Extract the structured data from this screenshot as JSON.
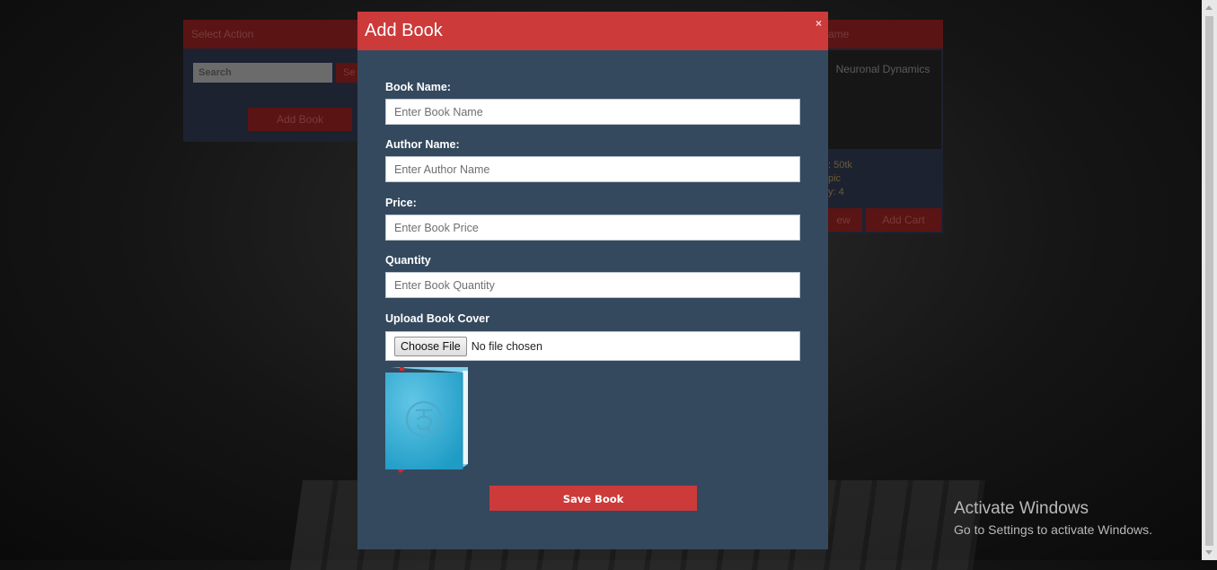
{
  "background": {
    "left_panel": {
      "header": "Select Action",
      "search_placeholder": "Search",
      "search_button": "Se",
      "add_button": "Add Book"
    },
    "right_panel": {
      "header": "ame",
      "cover_text": "Neuronal Dynamics",
      "line1": ": 50tk",
      "line2": "pic",
      "line3": "y: 4",
      "view_button": "ew",
      "cart_button": "Add Cart"
    }
  },
  "modal": {
    "title": "Add Book",
    "close": "×",
    "fields": {
      "book_name": {
        "label": "Book Name:",
        "placeholder": "Enter Book Name"
      },
      "author_name": {
        "label": "Author Name:",
        "placeholder": "Enter Author Name"
      },
      "price": {
        "label": "Price:",
        "placeholder": "Enter Book Price"
      },
      "quantity": {
        "label": "Quantity",
        "placeholder": "Enter Book Quantity"
      }
    },
    "upload": {
      "label": "Upload Book Cover",
      "button": "Choose File",
      "status": "No file chosen",
      "preview_icon": "book-cover-icon"
    },
    "save_button": "Save Book"
  },
  "watermark": {
    "title": "Activate Windows",
    "subtitle": "Go to Settings to activate Windows."
  },
  "colors": {
    "modal_bg": "#34495e",
    "accent": "#cc3a3a",
    "book_cover": "#33a9d1"
  }
}
